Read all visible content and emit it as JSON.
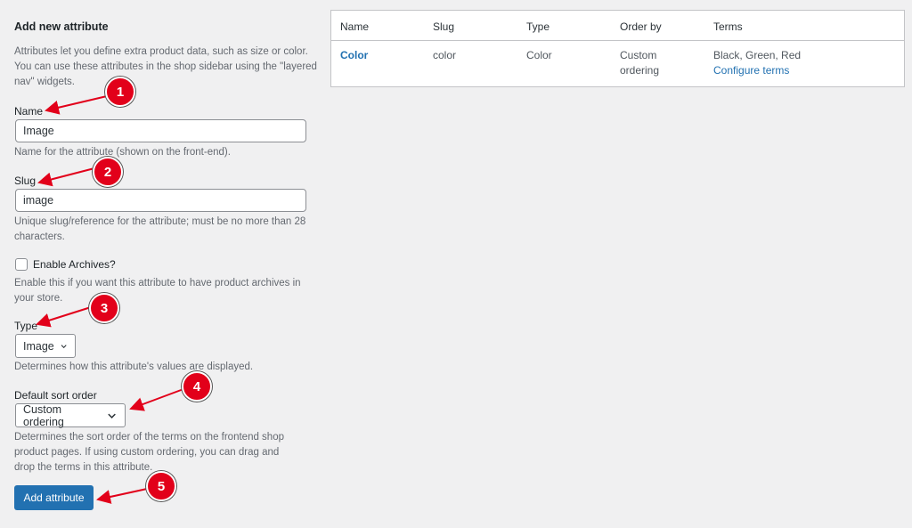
{
  "form": {
    "heading": "Add new attribute",
    "intro": "Attributes let you define extra product data, such as size or color. You can use these attributes in the shop sidebar using the \"layered nav\" widgets.",
    "name": {
      "label": "Name",
      "value": "Image",
      "help": "Name for the attribute (shown on the front-end)."
    },
    "slug": {
      "label": "Slug",
      "value": "image",
      "help": "Unique slug/reference for the attribute; must be no more than 28 characters."
    },
    "archives": {
      "label": "Enable Archives?",
      "help": "Enable this if you want this attribute to have product archives in your store."
    },
    "type": {
      "label": "Type",
      "value": "Image",
      "help": "Determines how this attribute's values are displayed."
    },
    "sort": {
      "label": "Default sort order",
      "value": "Custom ordering",
      "help": "Determines the sort order of the terms on the frontend shop product pages. If using custom ordering, you can drag and drop the terms in this attribute."
    },
    "submit_label": "Add attribute"
  },
  "table": {
    "headers": [
      "Name",
      "Slug",
      "Type",
      "Order by",
      "Terms"
    ],
    "rows": [
      {
        "name": "Color",
        "slug": "color",
        "type": "Color",
        "order_line1": "Custom",
        "order_line2": "ordering",
        "terms": "Black, Green, Red",
        "configure": "Configure terms"
      }
    ]
  },
  "annotations": [
    "1",
    "2",
    "3",
    "4",
    "5"
  ],
  "colors": {
    "accent": "#2271b1",
    "badge": "#e2001a"
  }
}
